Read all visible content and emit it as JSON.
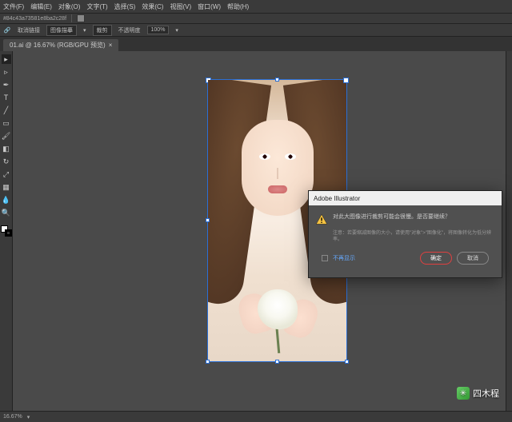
{
  "menu": {
    "items": [
      "文件(F)",
      "编辑(E)",
      "对象(O)",
      "文字(T)",
      "选择(S)",
      "效果(C)",
      "视图(V)",
      "窗口(W)",
      "帮助(H)"
    ]
  },
  "propbar": {
    "hex": "#84c43a73581e8ba2c28f"
  },
  "optbar": {
    "link_label": "取消链接",
    "trace_label": "图像描摹",
    "crop_label": "裁剪",
    "opacity_label": "不透明度",
    "opacity_value": "100%"
  },
  "tab": {
    "label": "01.ai @ 16.67% (RGB/GPU 预览)"
  },
  "dialog": {
    "title": "Adobe Illustrator",
    "message": "对此大图像进行裁剪可能会很慢。是否要继续？",
    "note": "注意：若要缩减图像的大小，请使用\"对象\">\"图像化\"，将图像转化为低分辨率。",
    "dont_show": "不再显示",
    "ok": "确定",
    "cancel": "取消"
  },
  "statusbar": {
    "zoom": "16.67%"
  },
  "watermark": {
    "text": "四木程"
  }
}
